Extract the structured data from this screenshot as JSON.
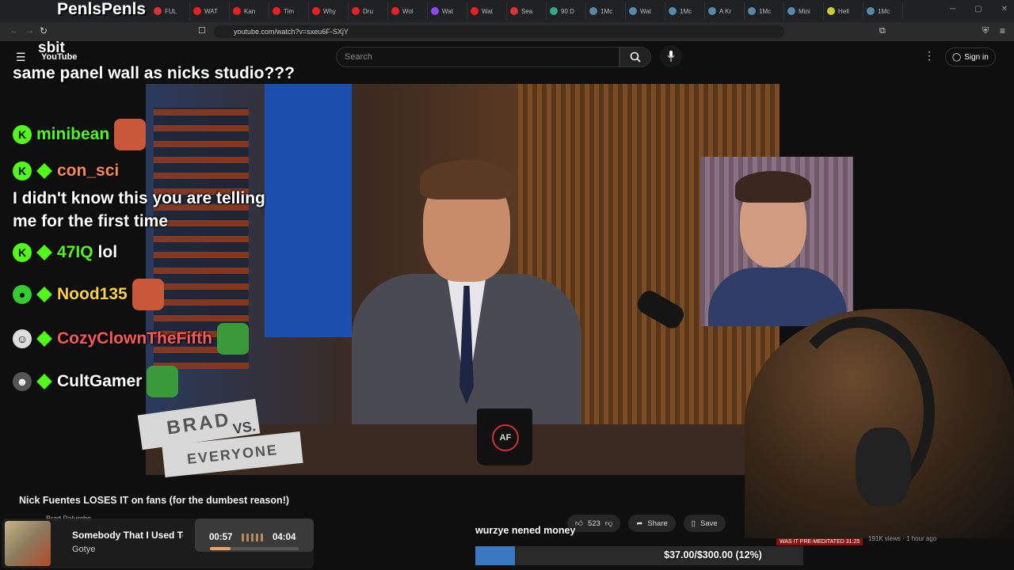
{
  "overlay": {
    "streamer_tag": "PenlsPenls",
    "username_top": "sbit"
  },
  "browser": {
    "tabs": [
      {
        "label": "FUL",
        "color": "#d33"
      },
      {
        "label": "WAT",
        "color": "#e22"
      },
      {
        "label": "Kan",
        "color": "#e22"
      },
      {
        "label": "Tim",
        "color": "#e22"
      },
      {
        "label": "Why",
        "color": "#e22"
      },
      {
        "label": "Dru",
        "color": "#e22"
      },
      {
        "label": "Wol",
        "color": "#e22"
      },
      {
        "label": "Wat",
        "color": "#9146ff"
      },
      {
        "label": "Wat",
        "color": "#e22"
      },
      {
        "label": "Sea",
        "color": "#d33"
      },
      {
        "label": "90 D",
        "color": "#3a8"
      },
      {
        "label": "1Mc",
        "color": "#58a"
      },
      {
        "label": "Wat",
        "color": "#58a"
      },
      {
        "label": "1Mc",
        "color": "#58a"
      },
      {
        "label": "A Kr",
        "color": "#58a"
      },
      {
        "label": "1Mc",
        "color": "#58a"
      },
      {
        "label": "Mini",
        "color": "#58a"
      },
      {
        "label": "Hell",
        "color": "#cc3"
      },
      {
        "label": "1Mc",
        "color": "#58a"
      }
    ],
    "url": "youtube.com/watch?v=sxeu6F-SXjY"
  },
  "youtube": {
    "logo": "YouTube",
    "search_placeholder": "Search",
    "sign_in": "Sign in",
    "video_title": "Nick Fuentes LOSES IT on fans (for the dumbest reason!)",
    "channel": "Brad Palumbo",
    "like_count": "523",
    "share_label": "Share",
    "save_label": "Save",
    "views_text": "191K views · 1 hour ago",
    "thumb_label": "WAS IT PRE-MEDITATED 31:25"
  },
  "chat": {
    "messages": [
      {
        "text": "same panel wall as nicks studio???"
      },
      {
        "user": "minibean",
        "color": "#53fc18"
      },
      {
        "user": "con_sci",
        "color": "#ff8c5a",
        "text": "I didn't know this you are telling me for the first time"
      },
      {
        "user": "47IQ",
        "color": "#53fc18",
        "text": "lol"
      },
      {
        "user": "Nood135",
        "color": "#ffd23f"
      },
      {
        "user": "CozyClownTheFifth",
        "color": "#ff5a5a"
      },
      {
        "user": "CultGamer",
        "color": "#ffffff"
      }
    ]
  },
  "video_overlay": {
    "brad_line1": "BRAD",
    "brad_vs": "VS.",
    "brad_line2": "EVERYONE",
    "mug_text": "AF"
  },
  "caption": "wurzye nened money",
  "now_playing": {
    "song": "Somebody That I Used To Know",
    "artist": "Gotye",
    "current": "00:57",
    "total": "04:04",
    "progress": 0.23
  },
  "goal": {
    "text": "$37.00/$300.00 (12%)",
    "fraction": 0.12
  },
  "colors": {
    "kick_green": "#53fc18",
    "yt_bg": "#0f0f0f"
  }
}
